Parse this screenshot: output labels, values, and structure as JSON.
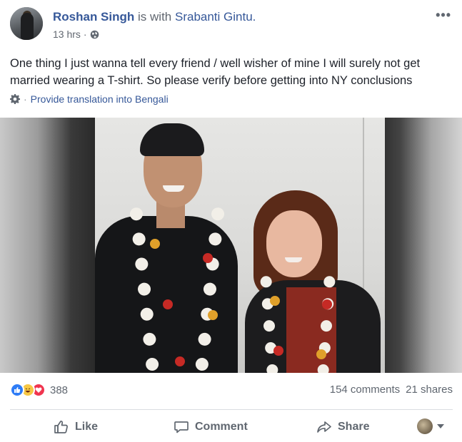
{
  "post": {
    "author": "Roshan Singh",
    "with_text": "is with",
    "tagged": "Srabanti Gintu.",
    "timestamp": "13 hrs",
    "separator": "·",
    "privacy_icon": "globe-icon",
    "more_icon": "•••",
    "text": "One thing I just wanna tell every friend / well wisher of mine I will surely not get married wearing a T-shirt. So please verify before getting into NY conclusions",
    "translate_label": "Provide translation into Bengali",
    "translate_separator": "·"
  },
  "stats": {
    "reaction_icons": [
      "like-icon",
      "haha-icon",
      "love-icon"
    ],
    "reaction_count": "388",
    "comments": "154 comments",
    "shares": "21 shares"
  },
  "actions": {
    "like_label": "Like",
    "comment_label": "Comment",
    "share_label": "Share"
  },
  "colors": {
    "link": "#365899",
    "meta": "#616770",
    "like_blue": "#2e7cf6",
    "love_red": "#f0354f",
    "haha_yellow": "#f7c845"
  }
}
